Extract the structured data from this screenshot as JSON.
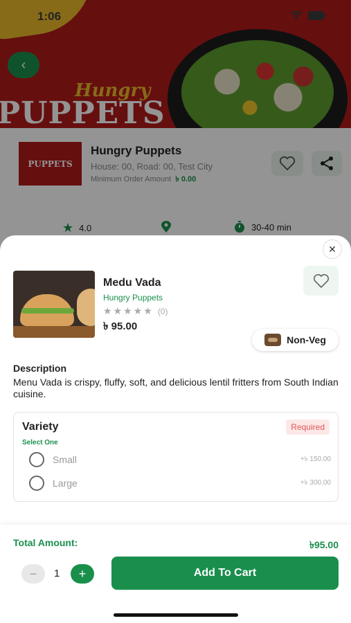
{
  "status_bar": {
    "time": "1:06"
  },
  "restaurant": {
    "cover_script": "Hungry",
    "cover_title": "PUPPETS",
    "logo_text": "PUPPETS",
    "name": "Hungry Puppets",
    "address": "House: 00, Road: 00, Test City",
    "min_order_label": "Minimum Order Amount",
    "min_order_value": "৳ 0.00",
    "rating": "4.0",
    "delivery_time": "30-40 min"
  },
  "item": {
    "name": "Medu Vada",
    "restaurant": "Hungry Puppets",
    "rating_count": "(0)",
    "rating_value": 0,
    "price": "৳ 95.00",
    "veg_label": "Non-Veg",
    "description_title": "Description",
    "description": "Menu Vada is crispy, fluffy, soft, and delicious lentil fritters from South Indian cuisine."
  },
  "variety": {
    "title": "Variety",
    "subtitle": "Select One",
    "required_label": "Required",
    "options": [
      {
        "label": "Small",
        "price": "+৳ 150.00"
      },
      {
        "label": "Large",
        "price": "+৳ 300.00"
      }
    ]
  },
  "cart": {
    "total_label": "Total Amount:",
    "total_value": "৳95.00",
    "quantity": "1",
    "minus_label": "−",
    "plus_label": "+",
    "add_label": "Add To Cart"
  },
  "colors": {
    "primary": "#1a8f4c",
    "cover": "#b01a1a",
    "required_bg": "#fde8e8",
    "required_text": "#e05555"
  }
}
